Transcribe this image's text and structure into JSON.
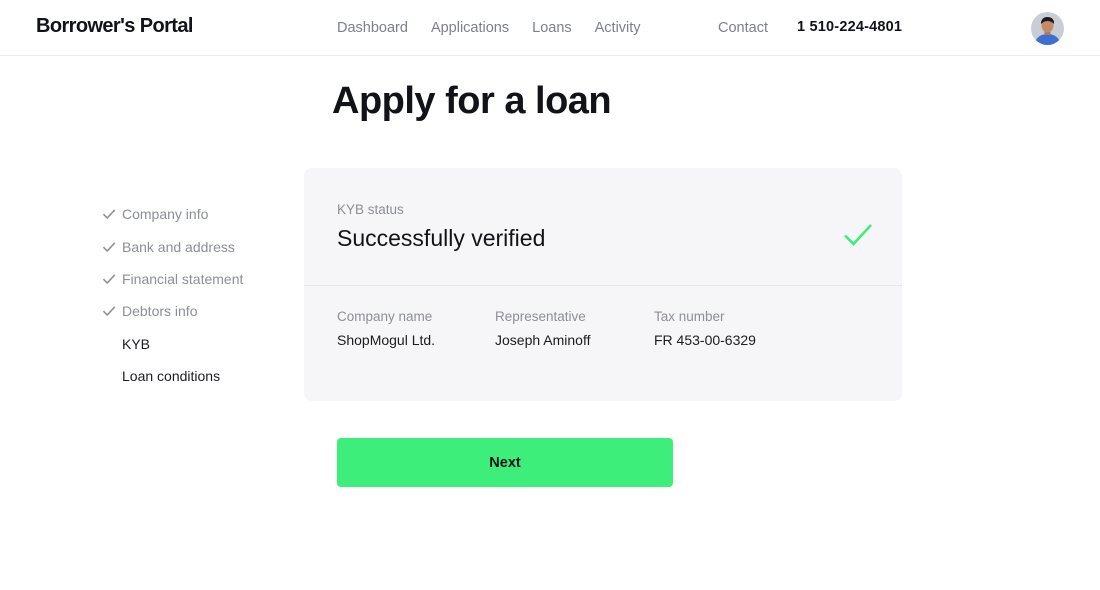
{
  "header": {
    "logo": "Borrower's Portal",
    "nav": [
      "Dashboard",
      "Applications",
      "Loans",
      "Activity"
    ],
    "contact": "Contact",
    "phone": "1 510-224-4801"
  },
  "page": {
    "title": "Apply for a loan"
  },
  "steps": [
    {
      "label": "Company info",
      "done": true
    },
    {
      "label": "Bank and address",
      "done": true
    },
    {
      "label": "Financial statement",
      "done": true
    },
    {
      "label": "Debtors info",
      "done": true
    },
    {
      "label": "KYB",
      "done": false
    },
    {
      "label": "Loan conditions",
      "done": false
    }
  ],
  "kyb": {
    "label": "KYB status",
    "status": "Successfully verified",
    "fields": [
      {
        "label": "Company name",
        "value": "ShopMogul Ltd."
      },
      {
        "label": "Representative",
        "value": "Joseph Aminoff"
      },
      {
        "label": "Tax number",
        "value": "FR 453-00-6329"
      }
    ]
  },
  "actions": {
    "next": "Next"
  },
  "colors": {
    "accent": "#3def7a",
    "muted": "#8b8f96",
    "card": "#f6f6f8"
  }
}
